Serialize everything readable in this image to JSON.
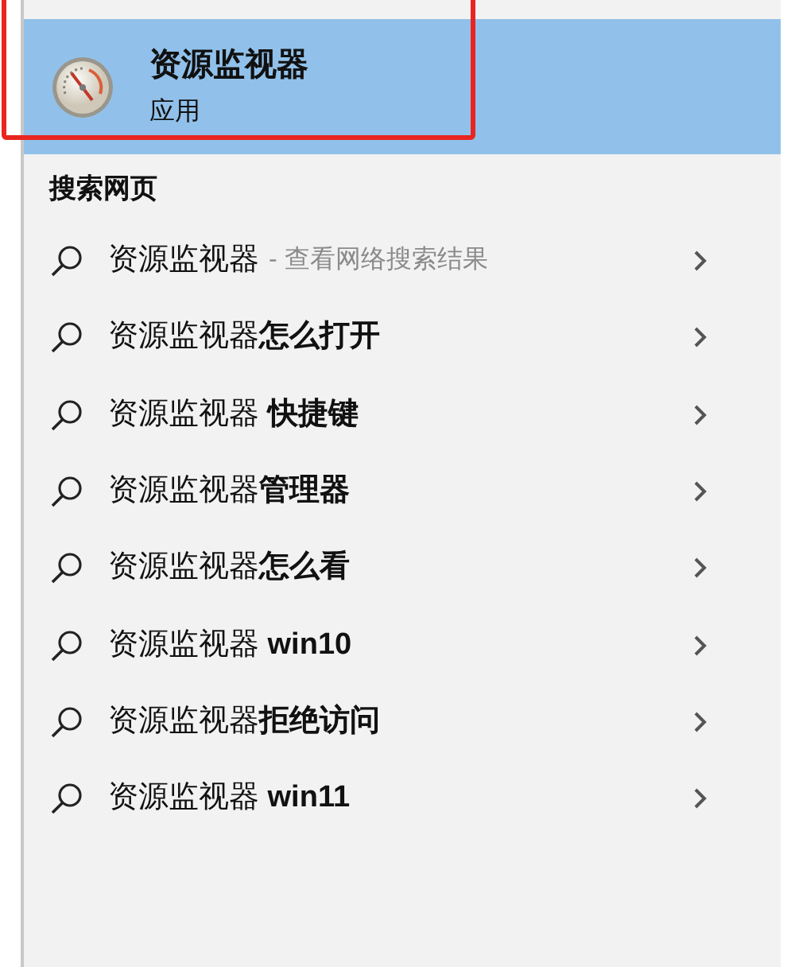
{
  "best_match": {
    "title": "资源监视器",
    "subtitle": "应用",
    "selected": true,
    "annotated": true
  },
  "section_title": "搜索网页",
  "suggestions": [
    {
      "text": "资源监视器",
      "hint": "- 查看网络搜索结果",
      "selected": false
    },
    {
      "text": "资源监视器**怎么打开**",
      "selected": false
    },
    {
      "text": "资源监视器 **快捷键**",
      "selected": false
    },
    {
      "text": "资源监视器**管理器**",
      "selected": false
    },
    {
      "text": "资源监视器**怎么看**",
      "selected": false
    },
    {
      "text": "资源监视器 **win10**",
      "selected": false
    },
    {
      "text": "资源监视器**拒绝访问**",
      "selected": false
    },
    {
      "text": "资源监视器 **win11**",
      "selected": false
    }
  ]
}
